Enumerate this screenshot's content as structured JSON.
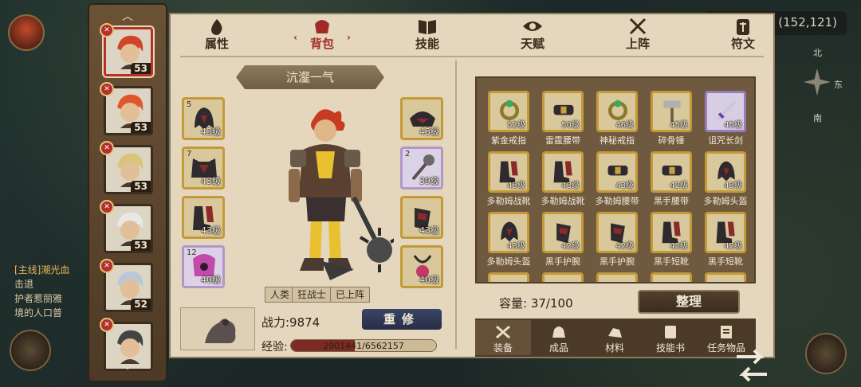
{
  "background": {
    "left_texts": [
      "[主线]潮光血",
      "击退",
      "护者惹丽雅",
      "境的人口普"
    ],
    "coords": "(152,121)",
    "compass": {
      "north": "北",
      "east": "东",
      "south": "南"
    }
  },
  "hero_list": [
    {
      "level": "53",
      "selected": true,
      "hair": "#d2442a"
    },
    {
      "level": "53",
      "selected": false,
      "hair": "#e0562e"
    },
    {
      "level": "53",
      "selected": false,
      "hair": "#d8c47a"
    },
    {
      "level": "53",
      "selected": false,
      "hair": "#e8e8e8"
    },
    {
      "level": "52",
      "selected": false,
      "hair": "#b8c8d8"
    },
    {
      "level": "",
      "selected": false,
      "hair": "#444444"
    }
  ],
  "tabs": [
    {
      "label": "属性",
      "icon": "flame-icon",
      "active": false
    },
    {
      "label": "背包",
      "icon": "bag-icon",
      "active": true
    },
    {
      "label": "技能",
      "icon": "book-icon",
      "active": false
    },
    {
      "label": "天赋",
      "icon": "eye-icon",
      "active": false
    },
    {
      "label": "上阵",
      "icon": "crossed-swords-icon",
      "active": false
    },
    {
      "label": "符文",
      "icon": "rune-icon",
      "active": false
    }
  ],
  "hero_name": "沆瀣一气",
  "equipment_left": [
    {
      "slot_num": "5",
      "level": "43级",
      "icon": "helmet-icon",
      "purple": false
    },
    {
      "slot_num": "7",
      "level": "43级",
      "icon": "armor-icon",
      "purple": false
    },
    {
      "slot_num": "",
      "level": "43级",
      "icon": "boots-icon",
      "purple": false
    },
    {
      "slot_num": "12",
      "level": "40级",
      "icon": "purple-armor-icon",
      "purple": true
    }
  ],
  "equipment_right": [
    {
      "slot_num": "",
      "level": "43级",
      "icon": "shoulder-icon",
      "purple": false
    },
    {
      "slot_num": "2",
      "level": "39级",
      "icon": "axe-icon",
      "purple": true
    },
    {
      "slot_num": "",
      "level": "43级",
      "icon": "bracer-icon",
      "purple": false
    },
    {
      "slot_num": "",
      "level": "40级",
      "icon": "amulet-icon",
      "purple": false
    }
  ],
  "hero_tags": [
    "人类",
    "狂战士",
    "已上阵"
  ],
  "power_label": "战力:9874",
  "renew_button": "重修",
  "exp_label": "经验:",
  "exp_text": "2901441/6562157",
  "exp_fraction": 0.442,
  "inventory": [
    {
      "name": "紫金戒指",
      "level": "52级",
      "icon": "ring-icon",
      "purple": false
    },
    {
      "name": "雷霆腰带",
      "level": "50级",
      "icon": "belt-icon",
      "purple": false
    },
    {
      "name": "神秘戒指",
      "level": "46级",
      "icon": "ring-icon",
      "purple": false
    },
    {
      "name": "碎骨锤",
      "level": "45级",
      "icon": "hammer-icon",
      "purple": false
    },
    {
      "name": "诅咒长剑",
      "level": "45级",
      "icon": "sword-icon",
      "purple": true
    },
    {
      "name": "多勒姆战靴",
      "level": "43级",
      "icon": "boots-icon",
      "purple": false
    },
    {
      "name": "多勒姆战靴",
      "level": "43级",
      "icon": "boots-icon",
      "purple": false
    },
    {
      "name": "多勒姆腰带",
      "level": "43级",
      "icon": "belt-icon",
      "purple": false
    },
    {
      "name": "黑手腰带",
      "level": "42级",
      "icon": "belt-icon",
      "purple": false
    },
    {
      "name": "多勒姆头盔",
      "level": "43级",
      "icon": "helmet-icon",
      "purple": false
    },
    {
      "name": "多勒姆头盔",
      "level": "43级",
      "icon": "helmet-icon",
      "purple": false
    },
    {
      "name": "黑手护腕",
      "level": "42级",
      "icon": "bracer-icon",
      "purple": false
    },
    {
      "name": "黑手护腕",
      "level": "42级",
      "icon": "bracer-icon",
      "purple": false
    },
    {
      "name": "黑手短靴",
      "level": "42级",
      "icon": "boots-icon",
      "purple": false
    },
    {
      "name": "黑手短靴",
      "level": "42级",
      "icon": "boots-icon",
      "purple": false
    },
    {
      "name": "",
      "level": "",
      "icon": "armor-icon",
      "purple": false
    },
    {
      "name": "",
      "level": "",
      "icon": "armor-icon",
      "purple": false
    },
    {
      "name": "",
      "level": "",
      "icon": "helmet-icon",
      "purple": false
    },
    {
      "name": "",
      "level": "",
      "icon": "helmet-icon",
      "purple": false
    },
    {
      "name": "",
      "level": "",
      "icon": "helmet-icon",
      "purple": false
    }
  ],
  "capacity_label": "容量:",
  "capacity_value": "37/100",
  "organize_button": "整理",
  "inventory_tabs": [
    {
      "label": "装备",
      "icon": "hammer-wrench-icon",
      "active": true
    },
    {
      "label": "成品",
      "icon": "pouch-icon",
      "active": false
    },
    {
      "label": "材料",
      "icon": "ore-icon",
      "active": false
    },
    {
      "label": "技能书",
      "icon": "scroll-icon",
      "active": false
    },
    {
      "label": "任务物品",
      "icon": "quest-scroll-icon",
      "active": false
    }
  ],
  "colors": {
    "panel_bg": "#e4d7bd",
    "gold_border": "#c49a38",
    "purple_border": "#9a7cbc",
    "accent_red": "#a22a24"
  }
}
